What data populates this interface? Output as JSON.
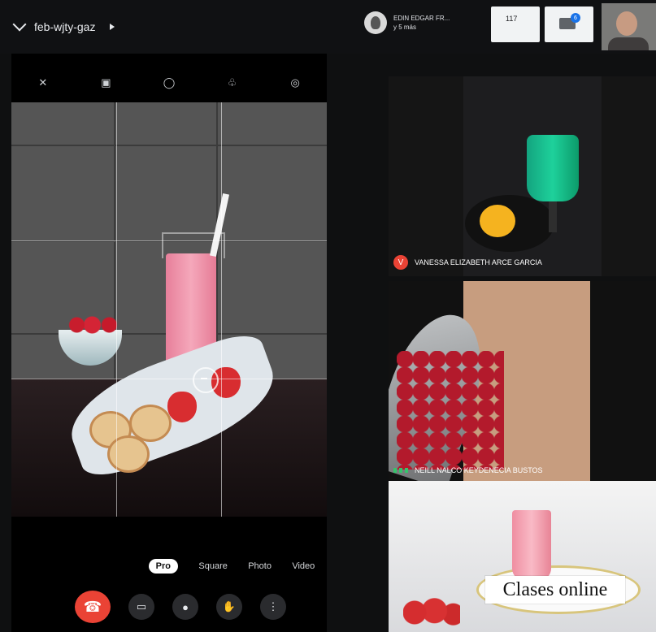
{
  "header": {
    "meeting_code": "feb-wjty-gaz",
    "host_name": "EDIN EDGAR FR...",
    "host_status": "y 5 más",
    "people_count": "117",
    "chat_badge": "6"
  },
  "left_camera": {
    "top_icons": [
      "flash-icon",
      "hdr-icon",
      "timer-icon",
      "filter-icon",
      "settings-icon"
    ],
    "zoom_labels": [
      "",
      "",
      "",
      "",
      ""
    ],
    "modes": [
      "Pro",
      "Square",
      "Photo",
      "Video"
    ],
    "active_mode": "Pro",
    "controls": [
      "end-call-icon",
      "video-icon",
      "mic-icon",
      "hand-icon",
      "more-icon"
    ]
  },
  "participants": [
    {
      "name": "VANESSA ELIZABETH ARCE GARCIA",
      "badge": "V"
    },
    {
      "name": "NEILL NALCO KEYDENECIA BUSTOS"
    },
    {
      "name": ""
    }
  ],
  "caption": "Clases online",
  "colors": {
    "end_call": "#ea4335",
    "accent_blue": "#1a73e8",
    "pink_drink": "#f5a8bb",
    "green_drink": "#1ed19b"
  }
}
